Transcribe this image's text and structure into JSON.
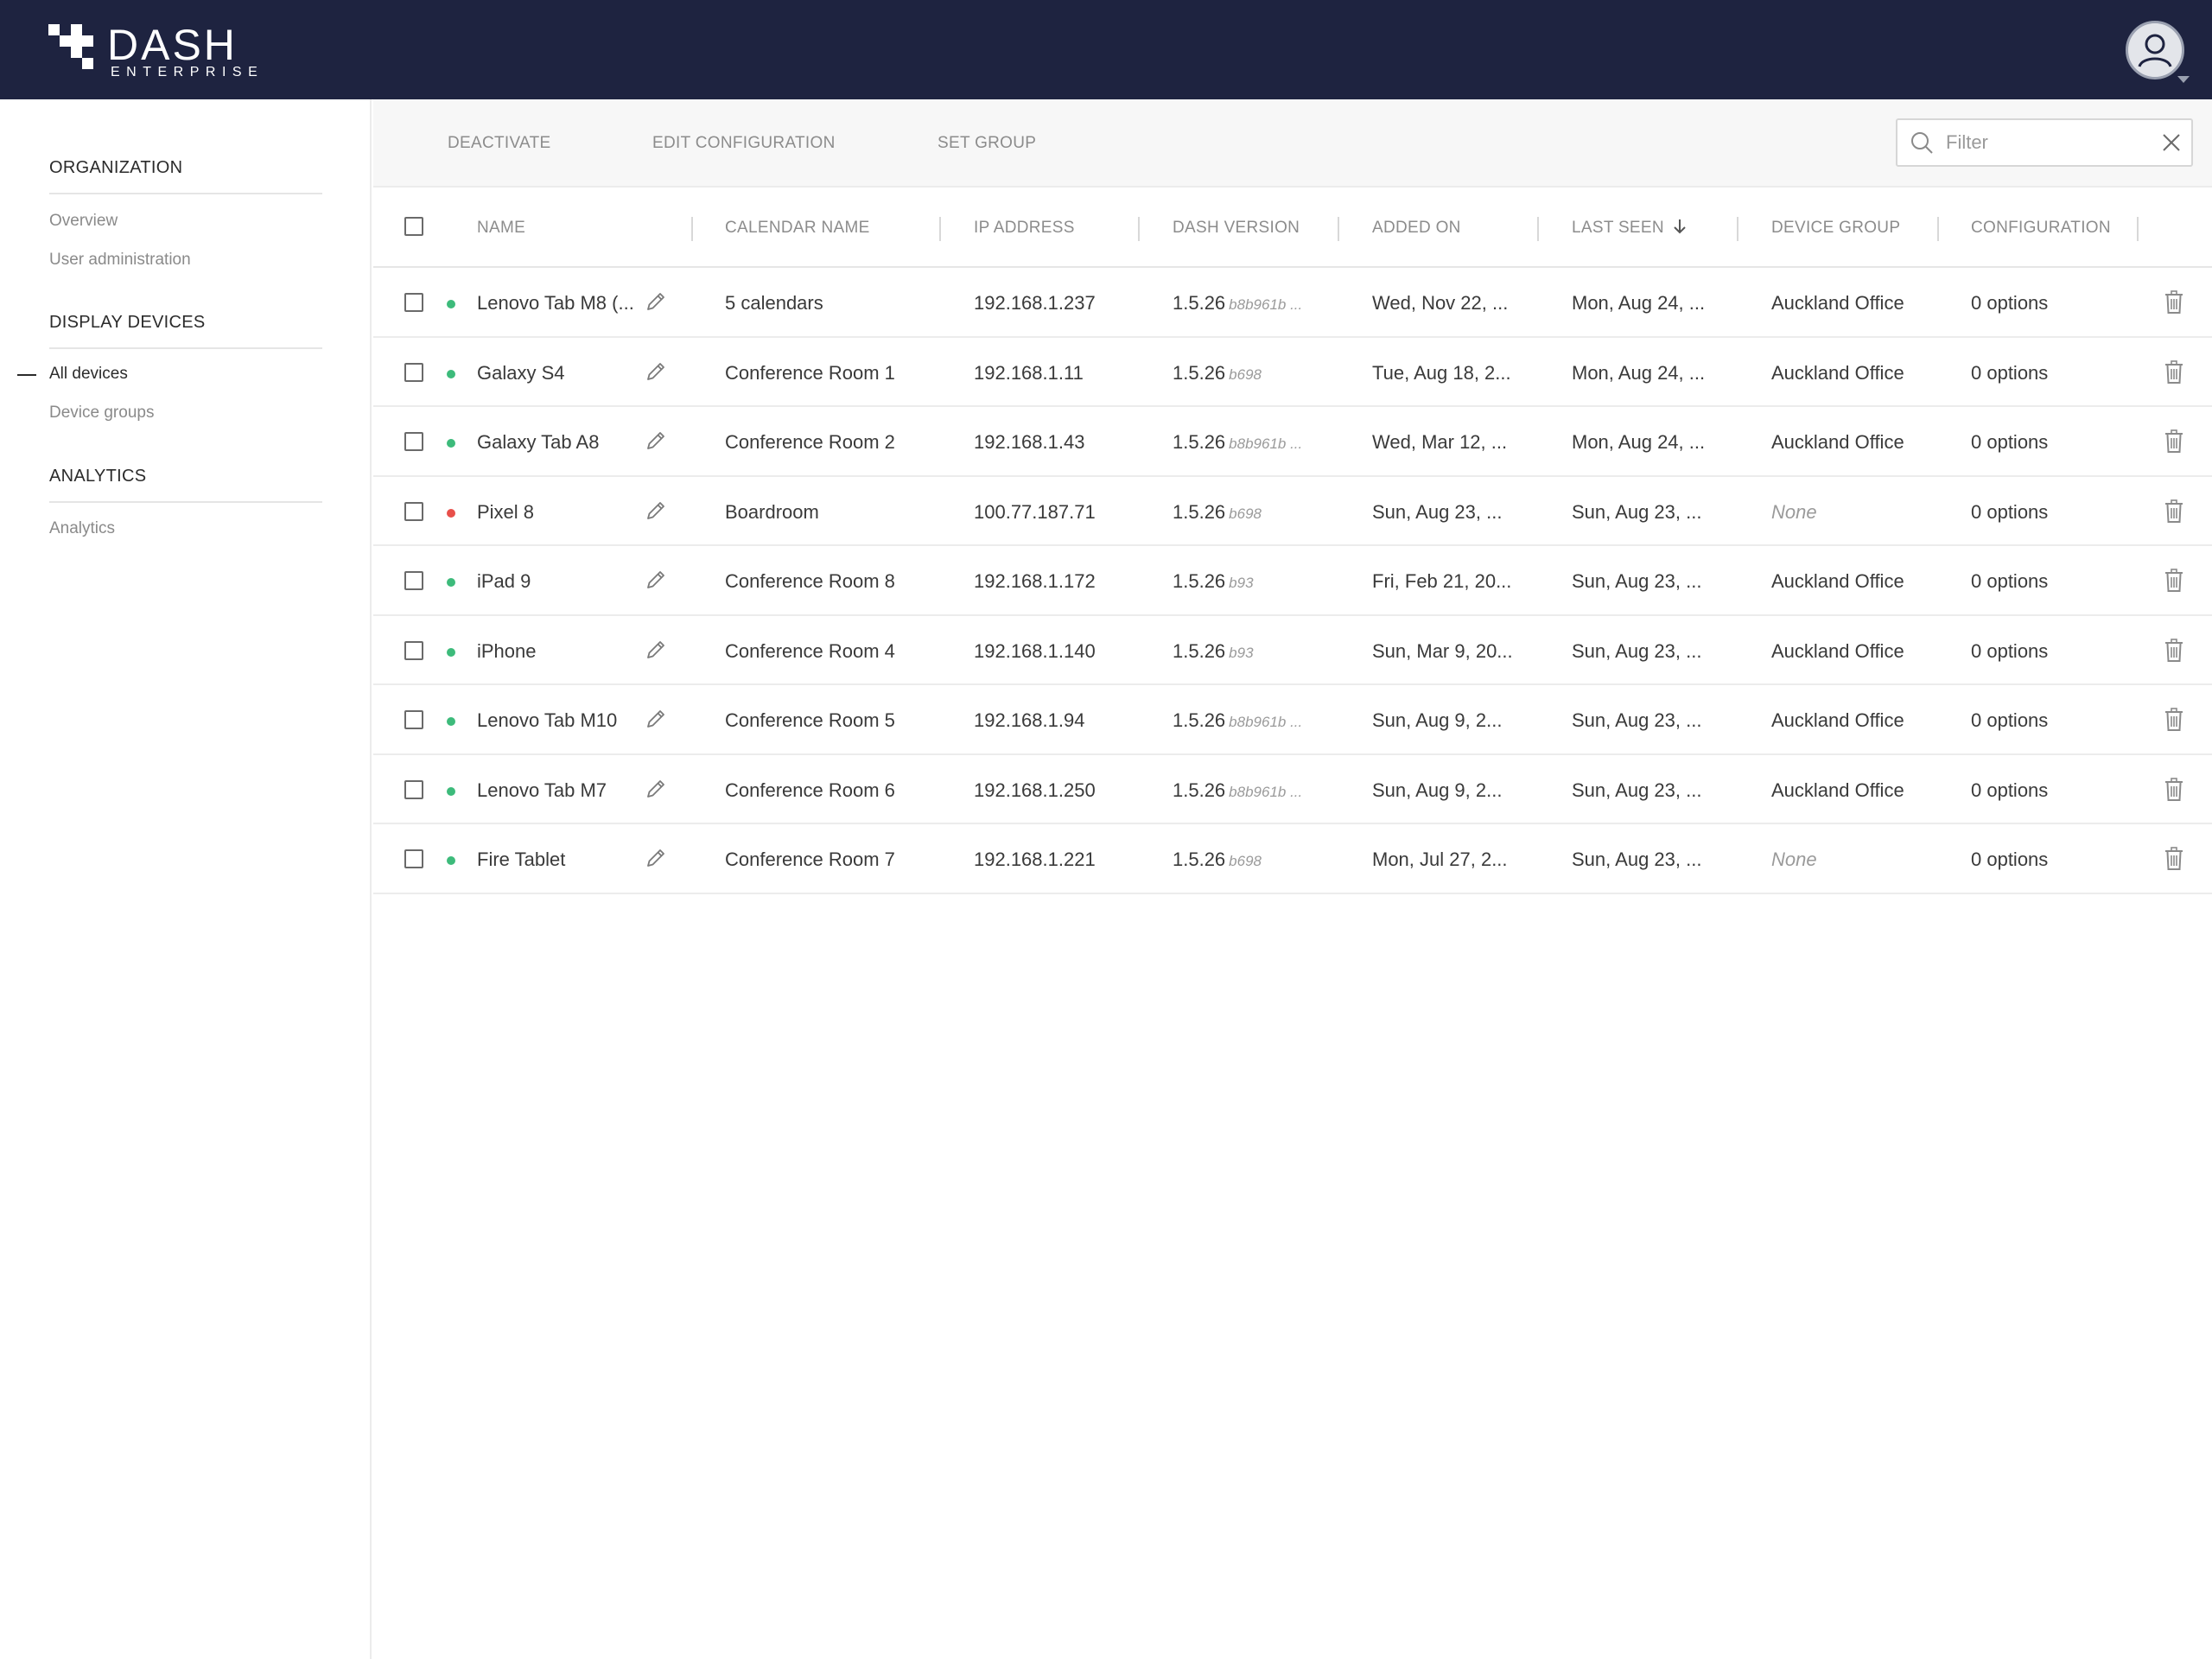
{
  "header": {
    "logo_main": "DASH",
    "logo_sub": "ENTERPRISE"
  },
  "sidebar": {
    "sections": [
      {
        "heading": "ORGANIZATION",
        "items": [
          "Overview",
          "User administration"
        ]
      },
      {
        "heading": "DISPLAY DEVICES",
        "items": [
          "All devices",
          "Device groups"
        ]
      },
      {
        "heading": "ANALYTICS",
        "items": [
          "Analytics"
        ]
      }
    ],
    "active_item": "All devices"
  },
  "toolbar": {
    "actions": [
      "DEACTIVATE",
      "EDIT CONFIGURATION",
      "SET GROUP"
    ],
    "filter_placeholder": "Filter"
  },
  "table": {
    "columns": [
      "NAME",
      "CALENDAR NAME",
      "IP ADDRESS",
      "DASH VERSION",
      "ADDED ON",
      "LAST SEEN",
      "DEVICE GROUP",
      "CONFIGURATION"
    ],
    "sorted_column": "LAST SEEN",
    "sort_direction": "descending",
    "rows": [
      {
        "status": "online",
        "name": "Lenovo Tab M8 (...",
        "calendar": "5 calendars",
        "ip": "192.168.1.237",
        "version": "1.5.26",
        "build": "b8b961b ...",
        "added": "Wed, Nov 22, ...",
        "last_seen": "Mon, Aug 24, ...",
        "group": "Auckland Office",
        "config": "0 options"
      },
      {
        "status": "online",
        "name": "Galaxy S4",
        "calendar": "Conference Room 1",
        "ip": "192.168.1.11",
        "version": "1.5.26",
        "build": "b698",
        "added": "Tue, Aug 18, 2...",
        "last_seen": "Mon, Aug 24, ...",
        "group": "Auckland Office",
        "config": "0 options"
      },
      {
        "status": "online",
        "name": "Galaxy Tab A8",
        "calendar": "Conference Room 2",
        "ip": "192.168.1.43",
        "version": "1.5.26",
        "build": "b8b961b ...",
        "added": "Wed, Mar 12, ...",
        "last_seen": "Mon, Aug 24, ...",
        "group": "Auckland Office",
        "config": "0 options"
      },
      {
        "status": "offline",
        "name": "Pixel 8",
        "calendar": "Boardroom",
        "ip": "100.77.187.71",
        "version": "1.5.26",
        "build": "b698",
        "added": "Sun, Aug 23, ...",
        "last_seen": "Sun, Aug 23, ...",
        "group": "None",
        "config": "0 options"
      },
      {
        "status": "online",
        "name": "iPad 9",
        "calendar": "Conference Room 8",
        "ip": "192.168.1.172",
        "version": "1.5.26",
        "build": "b93",
        "added": "Fri, Feb 21, 20...",
        "last_seen": "Sun, Aug 23, ...",
        "group": "Auckland Office",
        "config": "0 options"
      },
      {
        "status": "online",
        "name": "iPhone",
        "calendar": "Conference Room 4",
        "ip": "192.168.1.140",
        "version": "1.5.26",
        "build": "b93",
        "added": "Sun, Mar 9, 20...",
        "last_seen": "Sun, Aug 23, ...",
        "group": "Auckland Office",
        "config": "0 options"
      },
      {
        "status": "online",
        "name": "Lenovo Tab M10",
        "calendar": "Conference Room 5",
        "ip": "192.168.1.94",
        "version": "1.5.26",
        "build": "b8b961b ...",
        "added": "Sun, Aug 9, 2...",
        "last_seen": "Sun, Aug 23, ...",
        "group": "Auckland Office",
        "config": "0 options"
      },
      {
        "status": "online",
        "name": "Lenovo Tab M7",
        "calendar": "Conference Room 6",
        "ip": "192.168.1.250",
        "version": "1.5.26",
        "build": "b8b961b ...",
        "added": "Sun, Aug 9, 2...",
        "last_seen": "Sun, Aug 23, ...",
        "group": "Auckland Office",
        "config": "0 options"
      },
      {
        "status": "online",
        "name": "Fire Tablet",
        "calendar": "Conference Room 7",
        "ip": "192.168.1.221",
        "version": "1.5.26",
        "build": "b698",
        "added": "Mon, Jul 27, 2...",
        "last_seen": "Sun, Aug 23, ...",
        "group": "None",
        "config": "0 options"
      }
    ]
  },
  "colors": {
    "header_bg": "#1e2340",
    "status_online": "#3dbb7b",
    "status_offline": "#e8504a"
  },
  "icons": [
    "logo-icon",
    "avatar-icon",
    "search-icon",
    "close-icon",
    "sort-arrow-down-icon",
    "pencil-icon",
    "trash-icon"
  ]
}
